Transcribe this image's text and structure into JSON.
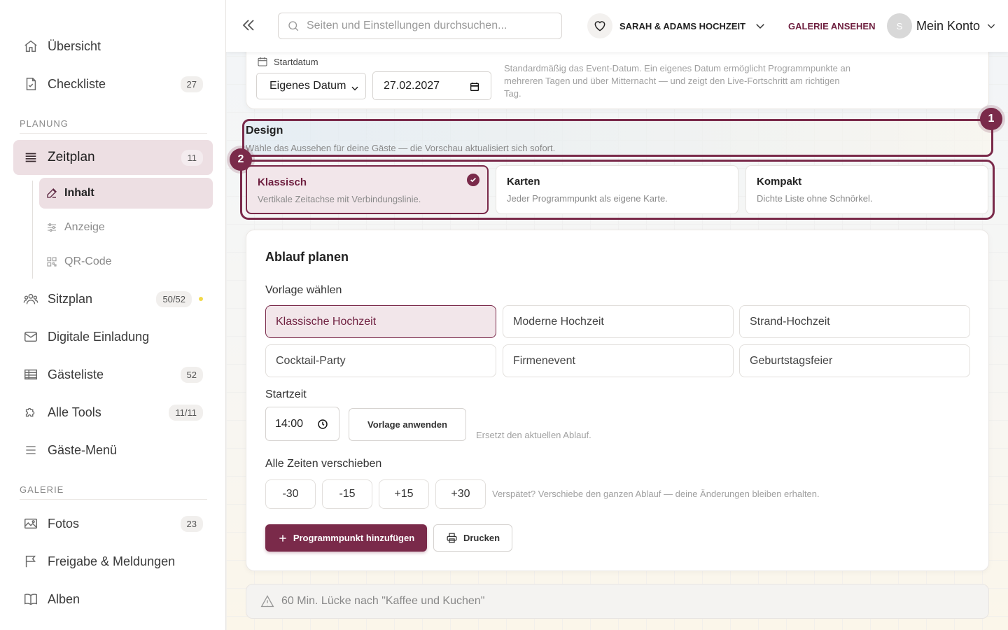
{
  "sidebar": {
    "top_items": [
      {
        "label": "Übersicht",
        "icon": "home-icon"
      },
      {
        "label": "Checkliste",
        "badge": "27",
        "icon": "checklist-icon"
      }
    ],
    "planung_label": "PLANUNG",
    "zeitplan": {
      "label": "Zeitplan",
      "badge": "11"
    },
    "zeitplan_sub": [
      {
        "label": "Inhalt",
        "icon": "edit-icon"
      },
      {
        "label": "Anzeige",
        "icon": "sliders-icon"
      },
      {
        "label": "QR-Code",
        "icon": "qr-code-icon"
      }
    ],
    "planung_items": [
      {
        "label": "Sitzplan",
        "badge": "50/52"
      },
      {
        "label": "Digitale Einladung"
      },
      {
        "label": "Gästeliste",
        "badge": "52"
      },
      {
        "label": "Alle Tools",
        "badge": "11/11"
      },
      {
        "label": "Gäste-Menü"
      }
    ],
    "galerie_label": "GALERIE",
    "galerie_items": [
      {
        "label": "Fotos",
        "badge": "23"
      },
      {
        "label": "Freigabe & Meldungen"
      },
      {
        "label": "Alben"
      }
    ]
  },
  "topbar": {
    "search_placeholder": "Seiten und Einstellungen durchsuchen...",
    "event_name": "SARAH & ADAMS HOCHZEIT",
    "galerie_link": "GALERIE ANSEHEN",
    "avatar_initial": "S",
    "account_label": "Mein Konto"
  },
  "startdatum": {
    "label": "Startdatum",
    "mode_value": "Eigenes Datum",
    "date_value": "27.02.2027",
    "help": "Standardmäßig das Event-Datum. Ein eigenes Datum ermöglicht Programmpunkte an mehreren Tagen und über Mitternacht — und zeigt den Live-Fortschritt am richtigen Tag."
  },
  "design": {
    "title": "Design",
    "subtitle": "Wähle das Aussehen für deine Gäste — die Vorschau aktualisiert sich sofort.",
    "step1": "1",
    "step2": "2",
    "options": [
      {
        "title": "Klassisch",
        "desc": "Vertikale Zeitachse mit Verbindungslinie.",
        "selected": true
      },
      {
        "title": "Karten",
        "desc": "Jeder Programmpunkt als eigene Karte.",
        "selected": false
      },
      {
        "title": "Kompakt",
        "desc": "Dichte Liste ohne Schnörkel.",
        "selected": false
      }
    ]
  },
  "plan": {
    "title": "Ablauf planen",
    "template_label": "Vorlage wählen",
    "templates": [
      "Klassische Hochzeit",
      "Moderne Hochzeit",
      "Strand-Hochzeit",
      "Cocktail-Party",
      "Firmenevent",
      "Geburtstagsfeier"
    ],
    "selected_template": "Klassische Hochzeit",
    "starttime_label": "Startzeit",
    "starttime_value": "14:00",
    "apply_button": "Vorlage anwenden",
    "apply_hint": "Ersetzt den aktuellen Ablauf.",
    "shift_label": "Alle Zeiten verschieben",
    "shift_buttons": [
      "-30",
      "-15",
      "+15",
      "+30"
    ],
    "shift_hint": "Verspätet? Verschiebe den ganzen Ablauf — deine Änderungen bleiben erhalten.",
    "add_button": "Programmpunkt hinzufügen",
    "print_button": "Drucken"
  },
  "warning": {
    "text": "60 Min. Lücke nach \"Kaffee und Kuchen\""
  },
  "colors": {
    "accent": "#7a2a4a",
    "accent_light": "#eddfe3",
    "sitzplan_dot": "#f2d94a"
  }
}
